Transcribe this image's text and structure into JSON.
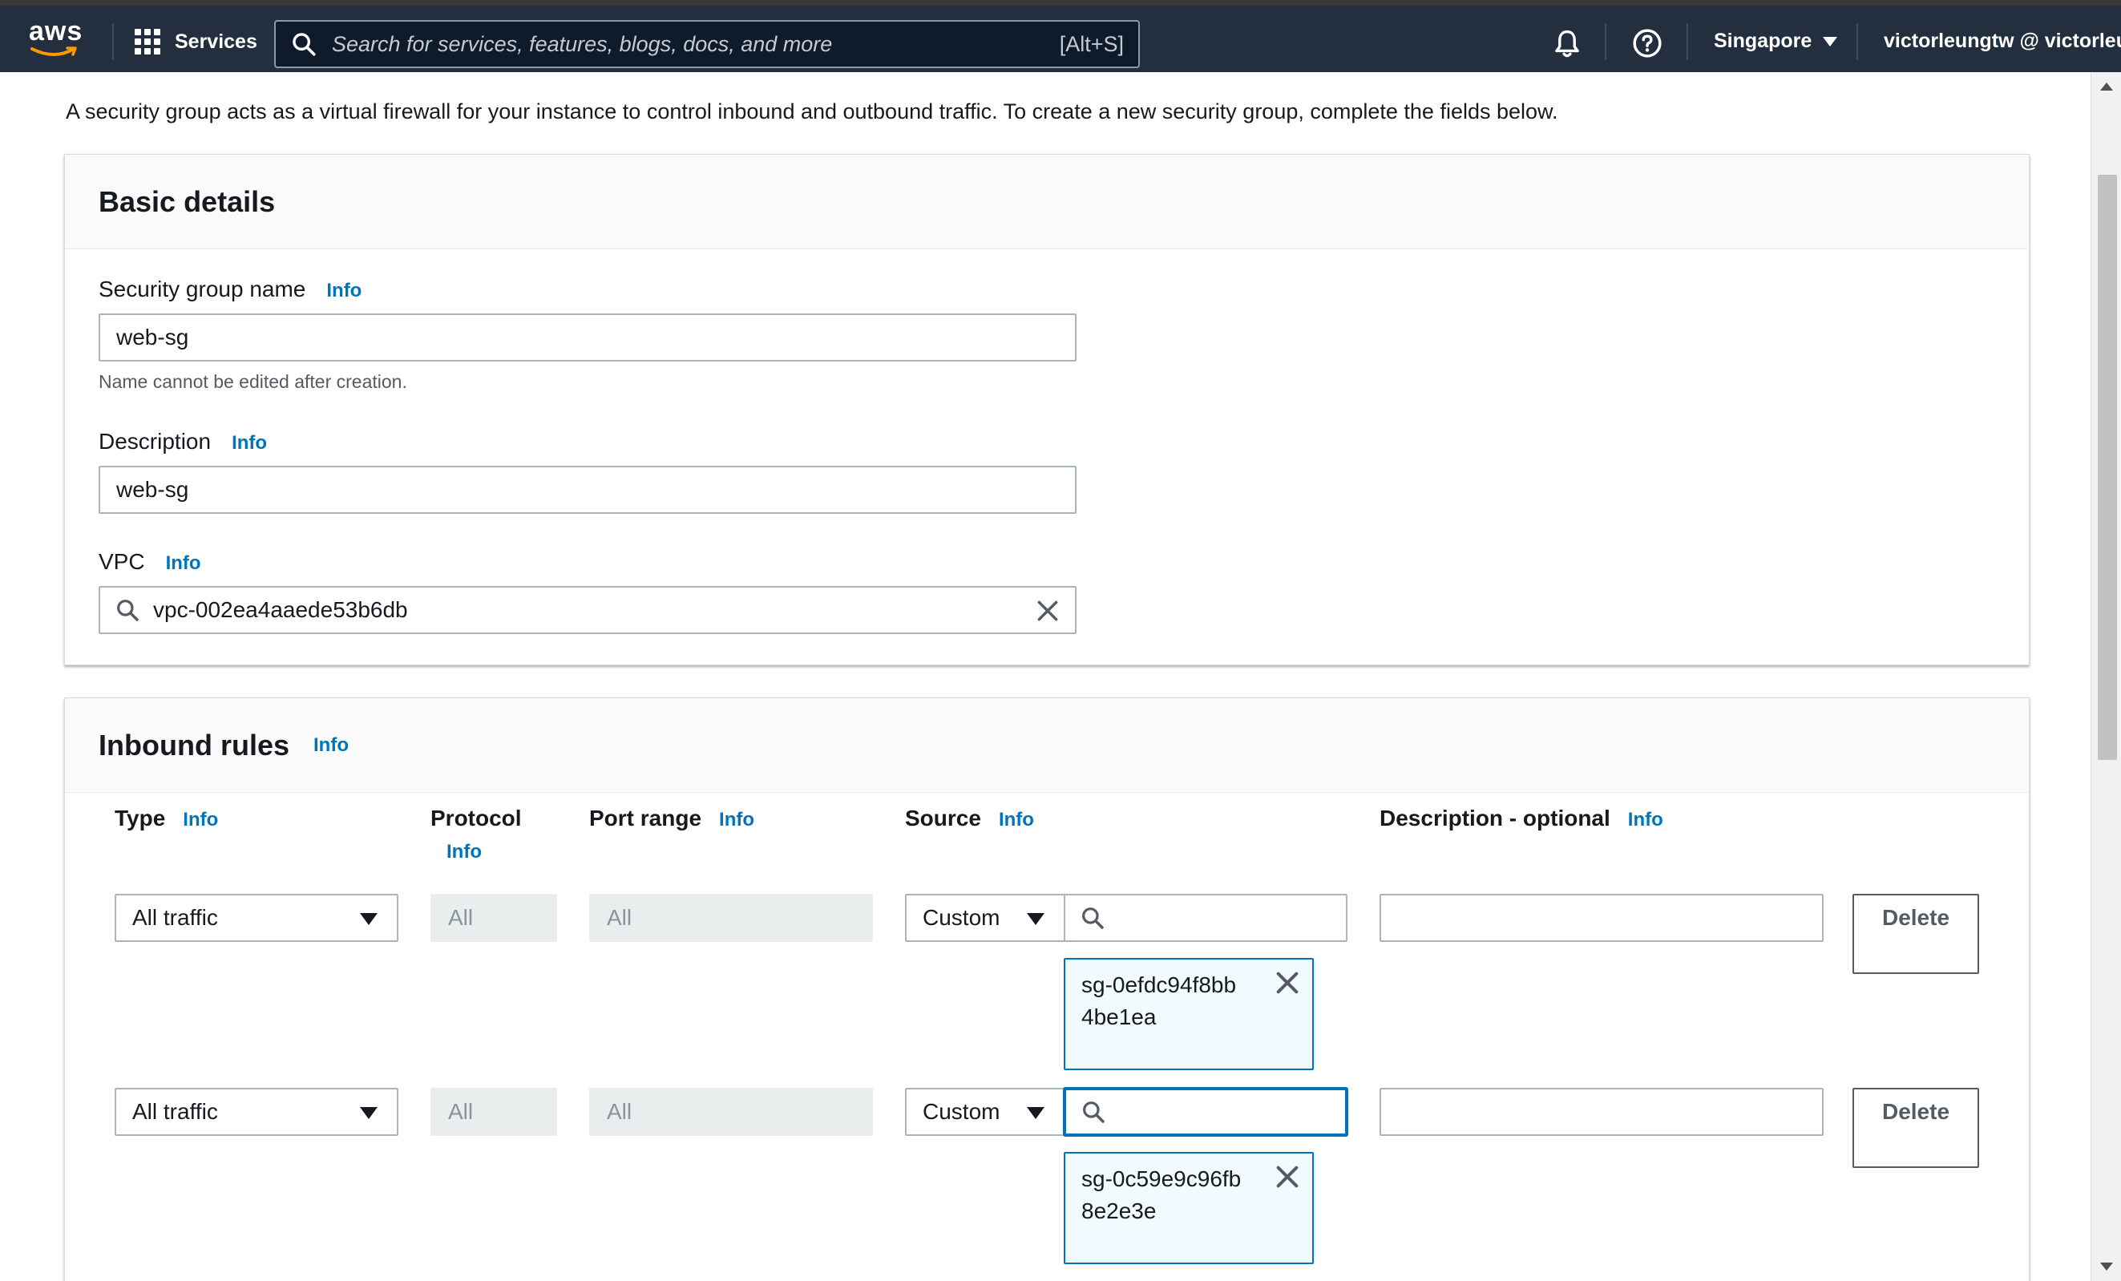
{
  "nav": {
    "brand": "aws",
    "services_label": "Services",
    "search_placeholder": "Search for services, features, blogs, docs, and more",
    "search_shortcut": "[Alt+S]",
    "region": "Singapore",
    "account": "victorleungtw @ victorleun"
  },
  "intro_text": "A security group acts as a virtual firewall for your instance to control inbound and outbound traffic. To create a new security group, complete the fields below.",
  "basic_details": {
    "title": "Basic details",
    "name_label": "Security group name",
    "name_info": "Info",
    "name_value": "web-sg",
    "name_hint": "Name cannot be edited after creation.",
    "description_label": "Description",
    "description_info": "Info",
    "description_value": "web-sg",
    "vpc_label": "VPC",
    "vpc_info": "Info",
    "vpc_value": "vpc-002ea4aaede53b6db"
  },
  "inbound": {
    "title": "Inbound rules",
    "title_info": "Info",
    "columns": {
      "type": "Type",
      "type_info": "Info",
      "protocol": "Protocol",
      "protocol_info": "Info",
      "port_range": "Port range",
      "port_range_info": "Info",
      "source": "Source",
      "source_info": "Info",
      "description": "Description - optional",
      "description_info": "Info"
    },
    "rules": [
      {
        "type": "All traffic",
        "protocol": "All",
        "port_range": "All",
        "source_type": "Custom",
        "source_token": "sg-0efdc94f8bb4be1ea",
        "delete_label": "Delete"
      },
      {
        "type": "All traffic",
        "protocol": "All",
        "port_range": "All",
        "source_type": "Custom",
        "source_token": "sg-0c59e9c96fb8e2e3e",
        "delete_label": "Delete"
      }
    ]
  },
  "colors": {
    "nav_bg": "#232f3e",
    "link_blue": "#0073bb",
    "token_bg": "#f1faff",
    "disabled_bg": "#eaeded"
  }
}
